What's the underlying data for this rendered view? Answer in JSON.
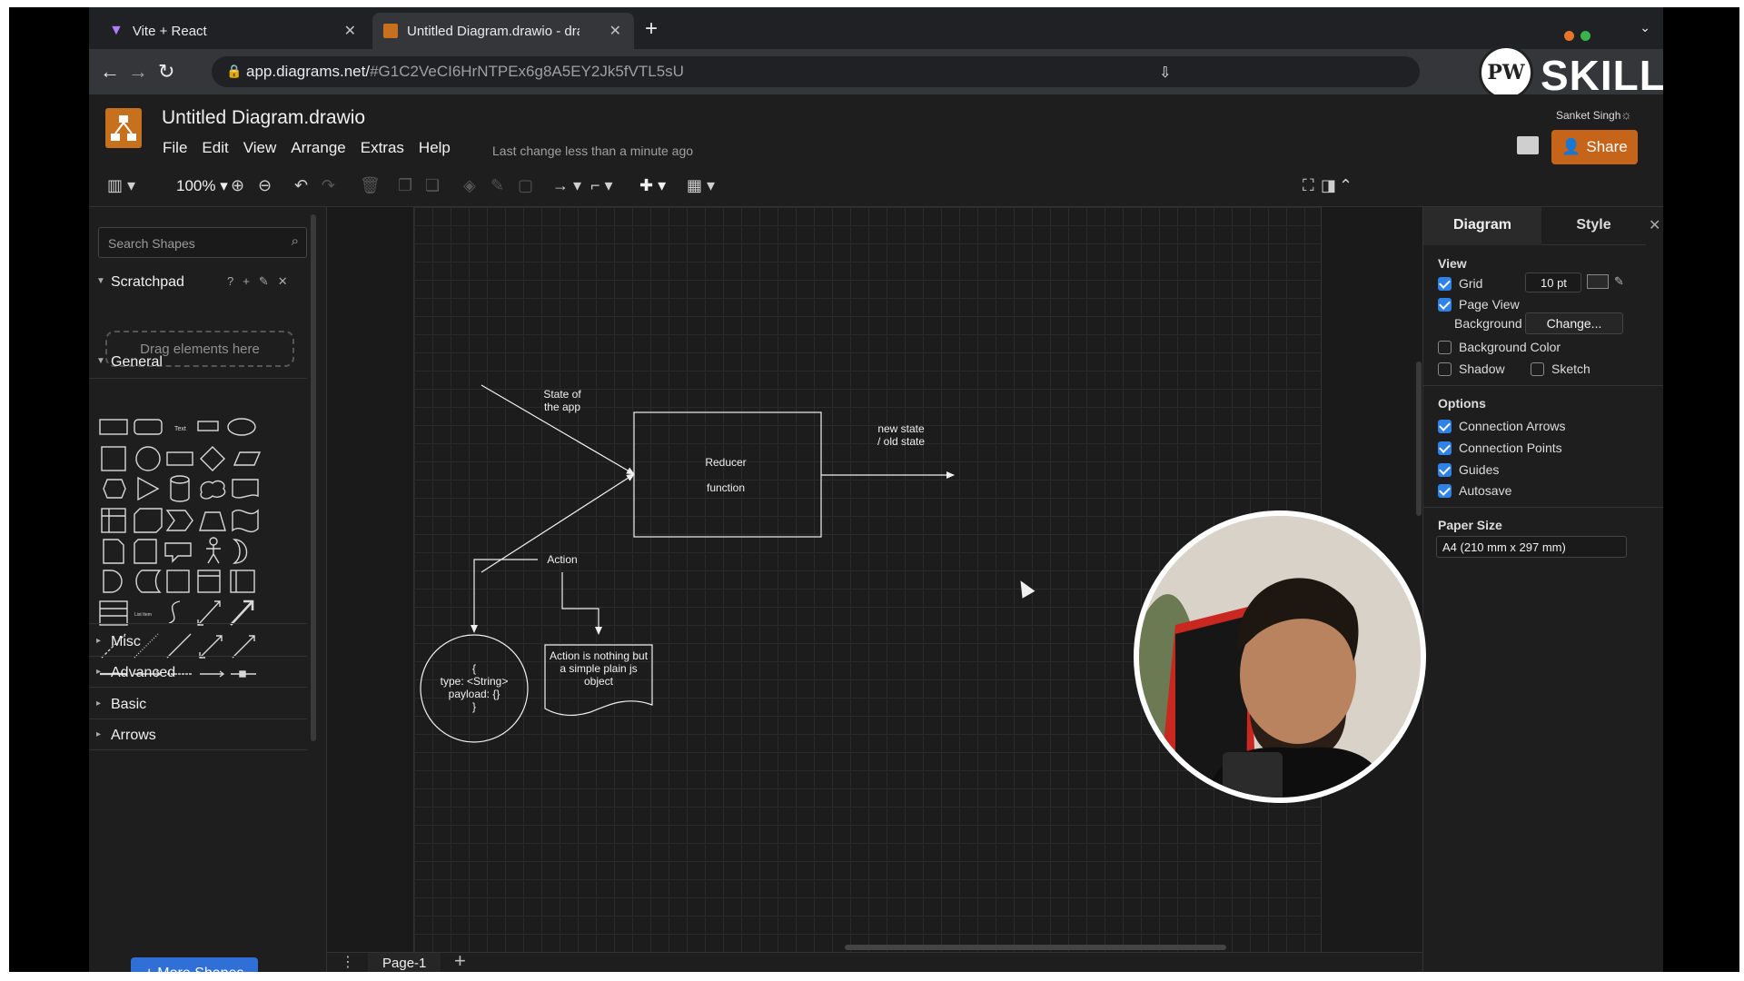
{
  "browser": {
    "tabs": [
      {
        "title": "Vite + React",
        "active": false
      },
      {
        "title": "Untitled Diagram.drawio - draw",
        "active": true
      }
    ],
    "url": {
      "host": "app.diagrams.net/",
      "hash": "#G1C2VeCI6HrNTPEx6g8A5EY2Jk5fVTL5sU"
    }
  },
  "watermark": {
    "text": "SKILLS",
    "badge": "PW"
  },
  "drawio": {
    "doc_title": "Untitled Diagram.drawio",
    "menu": [
      "File",
      "Edit",
      "View",
      "Arrange",
      "Extras",
      "Help"
    ],
    "last_change": "Last change less than a minute ago",
    "user_name": "Sanket Singh",
    "share_label": "Share",
    "zoom": "100%"
  },
  "sidebar": {
    "search_placeholder": "Search Shapes",
    "scratchpad_label": "Scratchpad",
    "scratchpad_hint": "Drag elements here",
    "general_label": "General",
    "sections": [
      "Misc",
      "Advanced",
      "Basic",
      "Arrows"
    ],
    "more_shapes": "+ More Shapes"
  },
  "diagram": {
    "label_state": [
      "State  of",
      "the app"
    ],
    "label_reducer": [
      "Reducer",
      "function"
    ],
    "label_new_state": [
      "new state",
      "/ old state"
    ],
    "label_action": "Action",
    "label_action_obj": [
      "{",
      "type: <String>",
      "payload: {}",
      "}"
    ],
    "label_action_note": [
      "Action is nothing but",
      "a simple plain js",
      "object"
    ]
  },
  "pages": {
    "current": "Page-1"
  },
  "format_panel": {
    "tab_diagram": "Diagram",
    "tab_style": "Style",
    "view_head": "View",
    "grid": {
      "label": "Grid",
      "checked": true,
      "size": "10 pt"
    },
    "page_view": {
      "label": "Page View",
      "checked": true
    },
    "background_label": "Background",
    "change_btn": "Change...",
    "background_color": {
      "label": "Background Color",
      "checked": false
    },
    "shadow": {
      "label": "Shadow",
      "checked": false
    },
    "sketch": {
      "label": "Sketch",
      "checked": false
    },
    "options_head": "Options",
    "options": [
      {
        "label": "Connection Arrows",
        "checked": true
      },
      {
        "label": "Connection Points",
        "checked": true
      },
      {
        "label": "Guides",
        "checked": true
      },
      {
        "label": "Autosave",
        "checked": true
      }
    ],
    "paper_head": "Paper Size",
    "paper_value": "A4 (210 mm x 297 mm)"
  },
  "colors": {
    "accent": "#c6641a",
    "checkbox": "#2f82e8",
    "more_shapes_btn": "#2f6fd6"
  }
}
